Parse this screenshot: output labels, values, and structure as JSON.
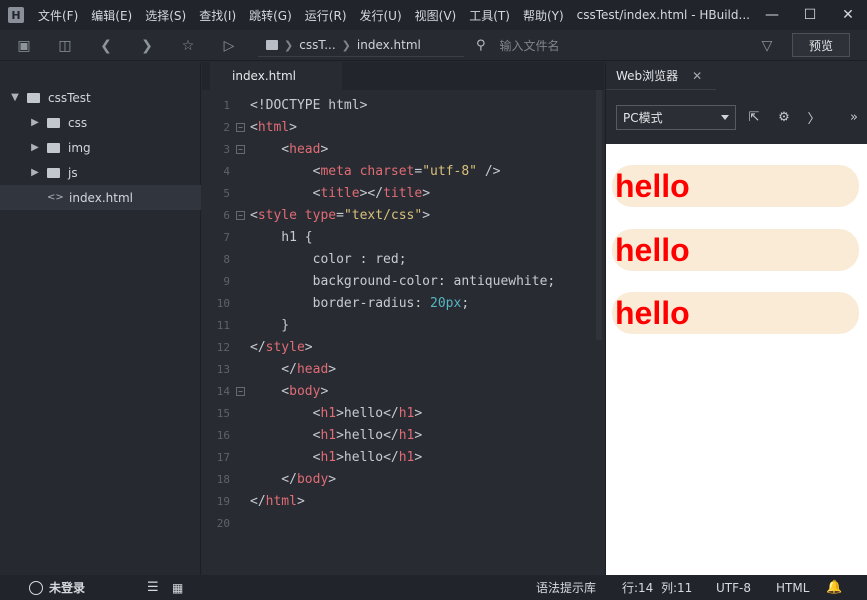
{
  "titlebar": {
    "logo": "H",
    "menu": [
      "文件(F)",
      "编辑(E)",
      "选择(S)",
      "查找(I)",
      "跳转(G)",
      "运行(R)",
      "发行(U)",
      "视图(V)",
      "工具(T)",
      "帮助(Y)"
    ],
    "title": "cssTest/index.html - HBuild...",
    "controls": [
      "minimize-icon",
      "maximize-icon",
      "close-icon"
    ]
  },
  "toolbar": {
    "breadcrumb": [
      "cssT...",
      "index.html"
    ],
    "search_placeholder": "输入文件名",
    "preview_label": "预览"
  },
  "sidebar": {
    "project": "cssTest",
    "items": [
      {
        "label": "css",
        "type": "folder"
      },
      {
        "label": "img",
        "type": "folder"
      },
      {
        "label": "js",
        "type": "folder"
      },
      {
        "label": "index.html",
        "type": "file"
      }
    ]
  },
  "editor": {
    "tab": "index.html",
    "line_numbers": [
      "1",
      "2",
      "3",
      "4",
      "5",
      "6",
      "7",
      "8",
      "9",
      "10",
      "11",
      "12",
      "13",
      "14",
      "15",
      "16",
      "17",
      "18",
      "19",
      "20"
    ]
  },
  "browser": {
    "tab_label": "Web浏览器",
    "mode": "PC模式",
    "headings": [
      "hello",
      "hello",
      "hello"
    ]
  },
  "statusbar": {
    "user": "未登录",
    "hint": "语法提示库",
    "line": "行:14",
    "col": "列:11",
    "encoding": "UTF-8",
    "language": "HTML"
  }
}
